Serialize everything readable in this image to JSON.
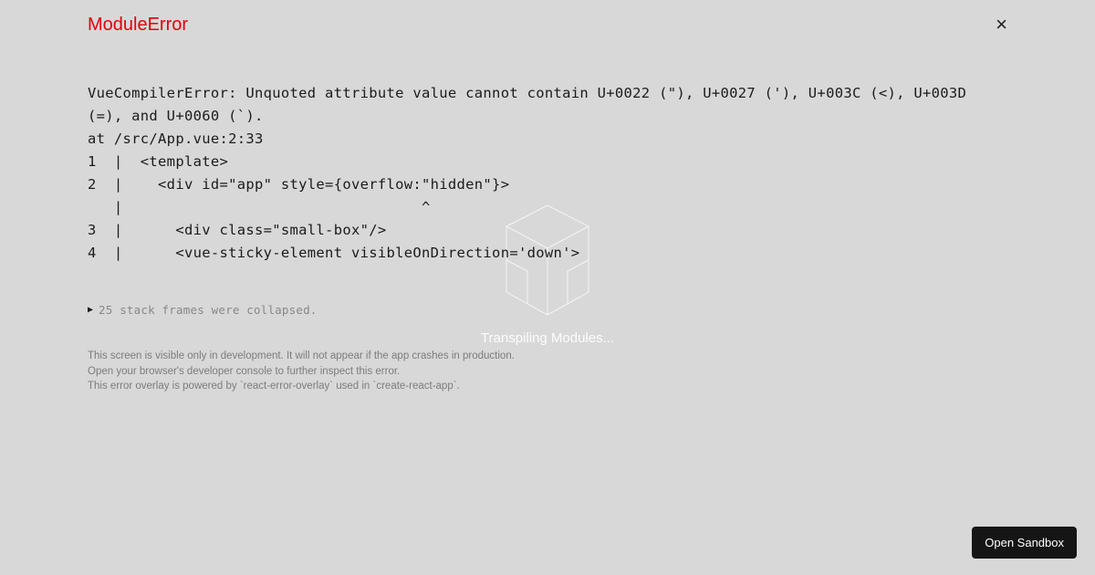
{
  "background": {
    "status_text": "Transpiling Modules..."
  },
  "error": {
    "title": "ModuleError",
    "message_line1": "VueCompilerError: Unquoted attribute value cannot contain U+0022 (\"), U+0027 ('), U+003C (<), U+003D",
    "message_line2": "(=), and U+0060 (`).",
    "location": "at /src/App.vue:2:33",
    "code_line1": "1  |  <template>",
    "code_line2": "2  |    <div id=\"app\" style={overflow:\"hidden\"}>",
    "caret_line": "   |                                  ^",
    "code_line3": "3  |      <div class=\"small-box\"/>",
    "code_line4": "4  |      <vue-sticky-element visibleOnDirection='down'>"
  },
  "stack": {
    "collapsed_text": "25 stack frames were collapsed."
  },
  "footer": {
    "line1": "This screen is visible only in development. It will not appear if the app crashes in production.",
    "line2": "Open your browser's developer console to further inspect this error.",
    "line3": "This error overlay is powered by `react-error-overlay` used in `create-react-app`."
  },
  "buttons": {
    "open_sandbox": "Open Sandbox"
  }
}
